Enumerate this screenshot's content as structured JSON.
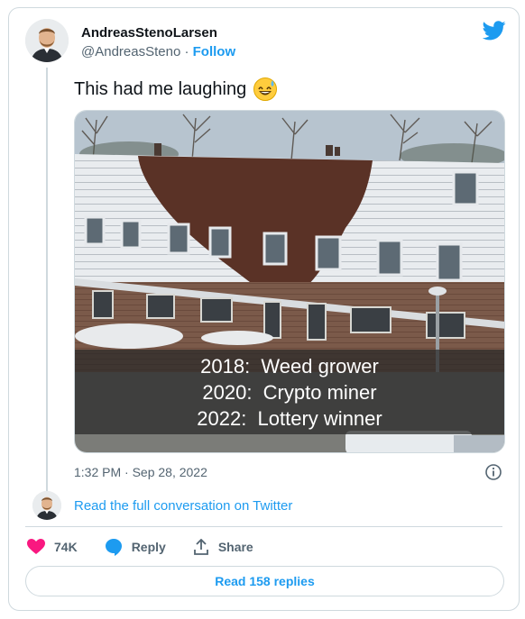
{
  "author": {
    "display_name": "AndreasStenoLarsen",
    "handle": "@AndreasSteno",
    "separator": " · ",
    "follow_label": "Follow"
  },
  "tweet": {
    "text": "This had me laughing",
    "emoji": "grinning-face-with-sweat"
  },
  "media": {
    "caption_lines": [
      "2018:  Weed grower",
      "2020:  Crypto miner",
      "2022:  Lottery winner"
    ]
  },
  "meta": {
    "timestamp": "1:32 PM · Sep 28, 2022"
  },
  "conversation": {
    "link_text": "Read the full conversation on Twitter"
  },
  "actions": {
    "like_count": "74K",
    "reply_label": "Reply",
    "share_label": "Share"
  },
  "footer": {
    "read_replies_label": "Read 158 replies"
  },
  "colors": {
    "accent": "#1d9bf0",
    "like": "#f91880",
    "border": "#cfd9de",
    "secondary_text": "#536471"
  }
}
